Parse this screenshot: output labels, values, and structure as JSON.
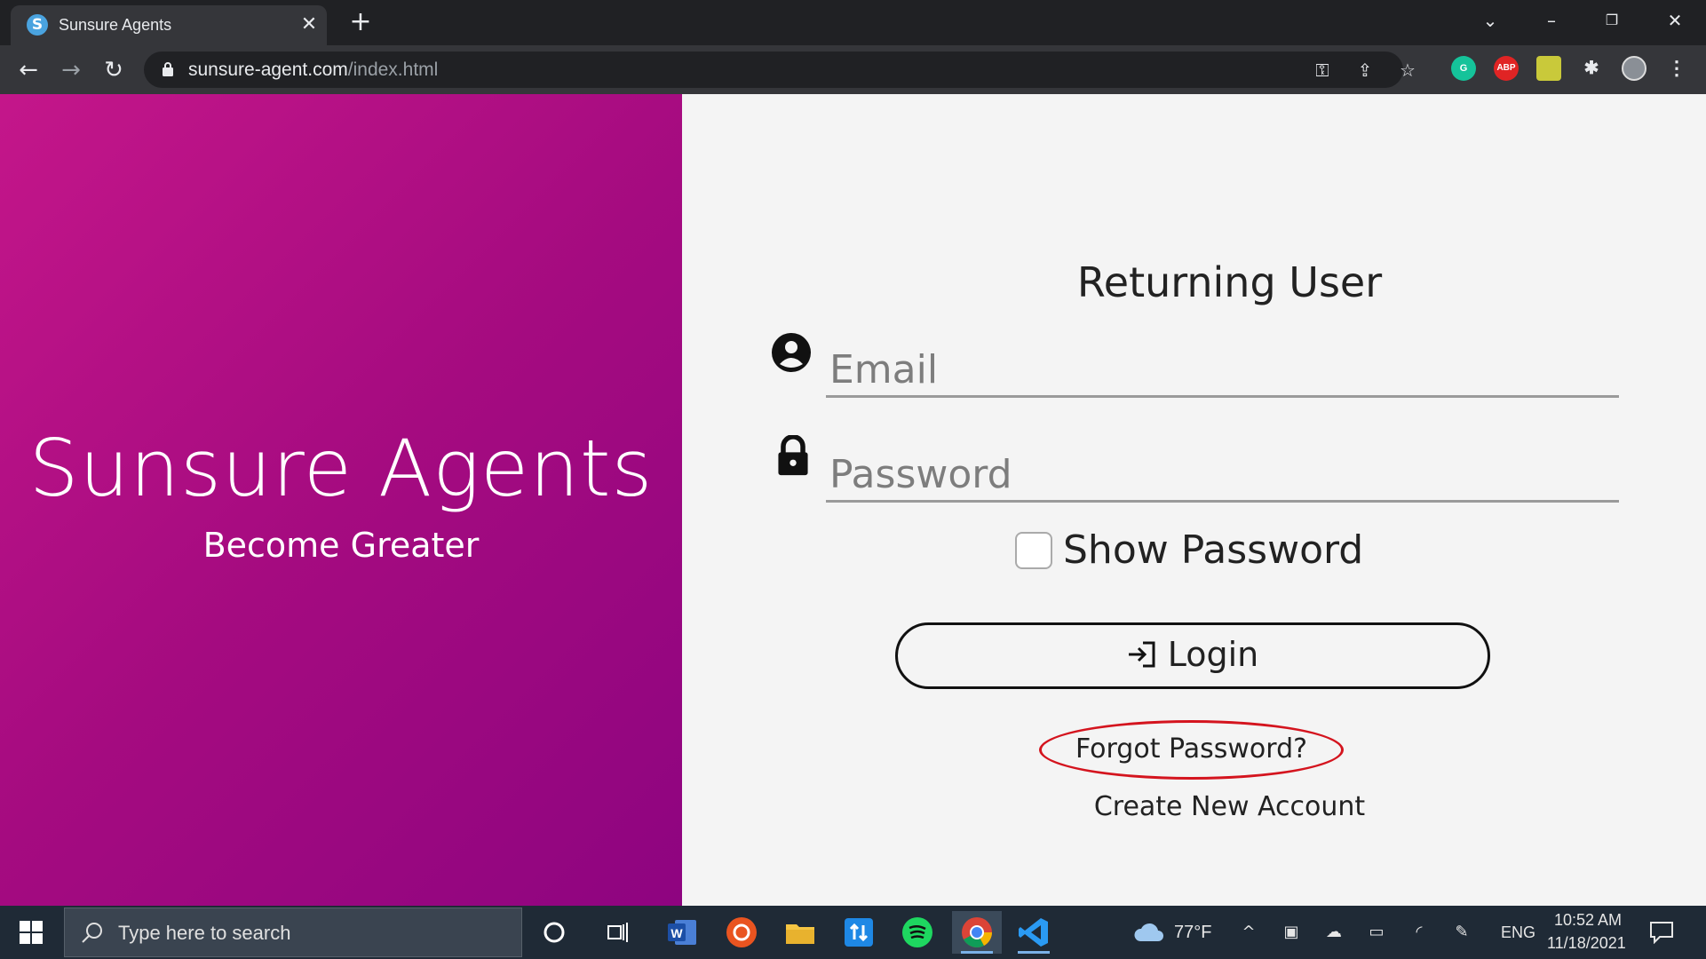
{
  "browser": {
    "tab_title": "Sunsure Agents",
    "tab_favicon_letter": "S",
    "url_domain": "sunsure-agent.com",
    "url_path": "/index.html"
  },
  "brand": {
    "title": "Sunsure Agents",
    "tagline": "Become Greater",
    "gradient_start": "#c4168a",
    "gradient_end": "#8e0480"
  },
  "login_form": {
    "heading": "Returning User",
    "email_placeholder": "Email",
    "password_placeholder": "Password",
    "show_password_label": "Show Password",
    "show_password_checked": false,
    "login_button_label": "Login",
    "forgot_password_link": "Forgot Password?",
    "create_account_link": "Create New Account",
    "highlight_color": "#d4141e"
  },
  "taskbar": {
    "search_placeholder": "Type here to search",
    "weather_temp": "77°F",
    "language": "ENG",
    "time": "10:52 AM",
    "date": "11/18/2021"
  },
  "extensions": {
    "abp_label": "ABP"
  }
}
